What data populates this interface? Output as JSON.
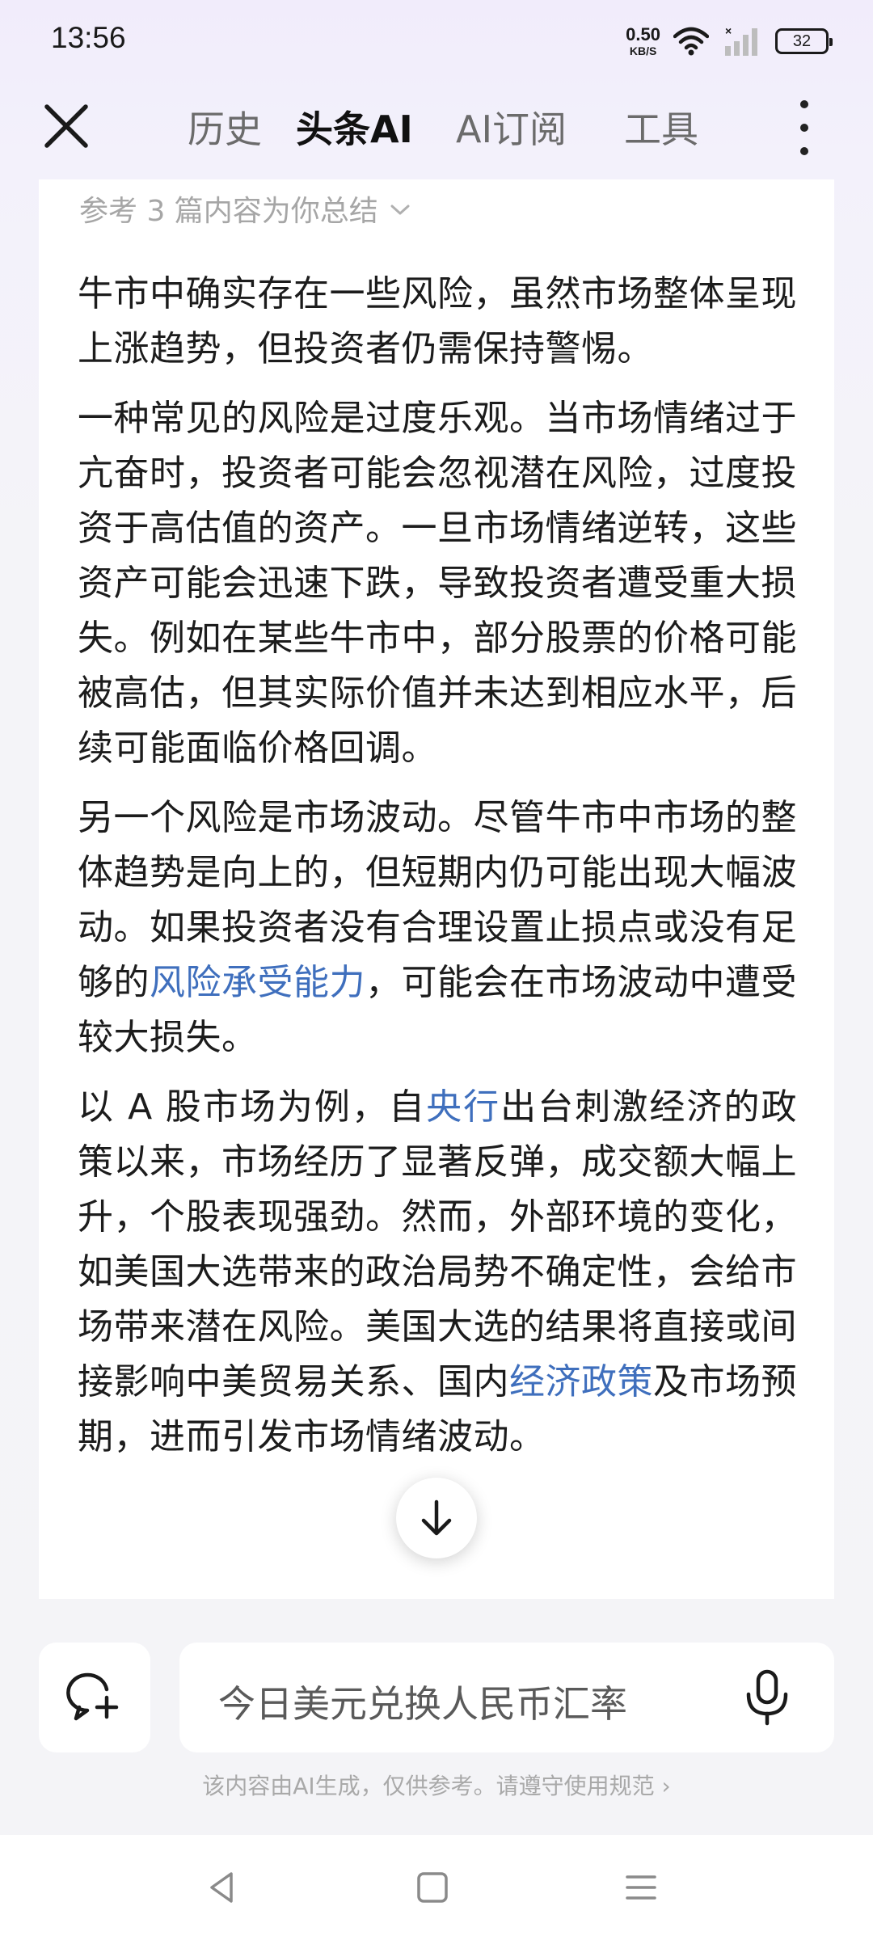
{
  "status": {
    "time": "13:56",
    "net_speed_value": "0.50",
    "net_speed_unit": "KB/S",
    "battery": "32"
  },
  "nav": {
    "tabs": [
      {
        "label": "历史"
      },
      {
        "label": "头条AI"
      },
      {
        "label": "AI订阅"
      },
      {
        "label": "工具"
      }
    ]
  },
  "content": {
    "reference_summary": "参考 3 篇内容为你总结",
    "para1": "牛市中确实存在一些风险，虽然市场整体呈现上涨趋势，但投资者仍需保持警惕。",
    "para2": "一种常见的风险是过度乐观。当市场情绪过于亢奋时，投资者可能会忽视潜在风险，过度投资于高估值的资产。一旦市场情绪逆转，这些资产可能会迅速下跌，导致投资者遭受重大损失。例如在某些牛市中，部分股票的价格可能被高估，但其实际价值并未达到相应水平，后续可能面临价格回调。",
    "para3_a": "另一个风险是市场波动。尽管牛市中市场的整体趋势是向上的，但短期内仍可能出现大幅波动。如果投资者没有合理设置止损点或没有足够的",
    "para3_link": "风险承受能力",
    "para3_b": "，可能会在市场波动中遭受较大损失。",
    "para4_a": "以 A 股市场为例，自",
    "para4_link1": "央行",
    "para4_b": "出台刺激经济的政策以来，市场经历了显著反弹，成交额大幅上升，个股表现强劲。然而，外部环境的变化，如美国大选带来的政治局势不确定性，会给市场带来潜在风险。美国大选的结果将直接或间接影响中美贸易关系、国内",
    "para4_link2": "经济政策",
    "para4_c": "及市场预期，进而引发市场情绪波动。"
  },
  "input": {
    "placeholder": "今日美元兑换人民币汇率"
  },
  "disclaimer": "该内容由AI生成，仅供参考。请遵守使用规范 ›"
}
